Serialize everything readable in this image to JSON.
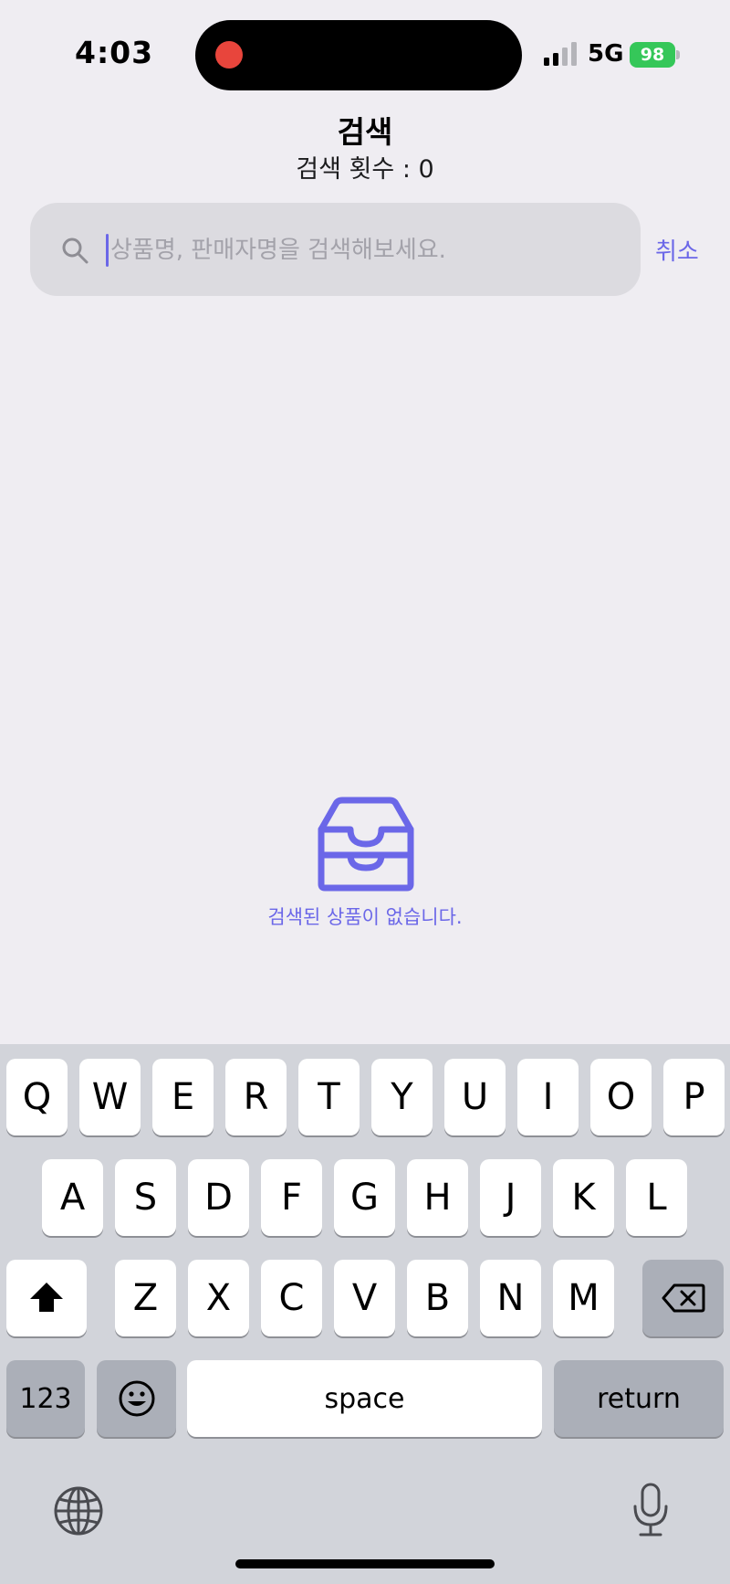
{
  "status": {
    "time": "4:03",
    "network": "5G",
    "battery": "98"
  },
  "header": {
    "title": "검색",
    "count_label": "검색 횟수 : 0"
  },
  "search": {
    "placeholder": "상품명, 판매자명을 검색해보세요.",
    "value": "",
    "cancel_label": "취소"
  },
  "empty_state": {
    "message": "검색된 상품이 없습니다."
  },
  "keyboard": {
    "row1": [
      "Q",
      "W",
      "E",
      "R",
      "T",
      "Y",
      "U",
      "I",
      "O",
      "P"
    ],
    "row2": [
      "A",
      "S",
      "D",
      "F",
      "G",
      "H",
      "J",
      "K",
      "L"
    ],
    "row3": [
      "Z",
      "X",
      "C",
      "V",
      "B",
      "N",
      "M"
    ],
    "numbers_label": "123",
    "space_label": "space",
    "return_label": "return"
  },
  "colors": {
    "accent": "#6b67e8",
    "background": "#efedf2",
    "search_bg": "#dcdbe0",
    "record": "#e8453c",
    "battery": "#35c759"
  },
  "icons": [
    "search-icon",
    "empty-box-icon",
    "shift-icon",
    "delete-icon",
    "emoji-icon",
    "globe-icon",
    "microphone-icon",
    "signal-icon"
  ]
}
